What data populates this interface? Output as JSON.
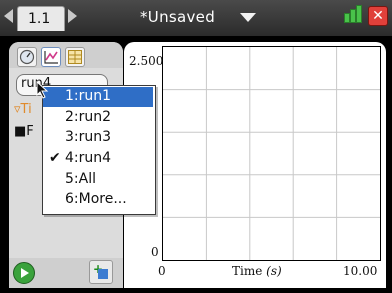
{
  "topbar": {
    "page_tab": "1.1",
    "document_title": "*Unsaved",
    "close_symbol": "✕"
  },
  "left_panel": {
    "run_selector_value": "run4",
    "tree_label": "▿Ti",
    "legend_label": "■F"
  },
  "graph": {
    "y_max": "2.500",
    "y_min": "0",
    "x_min": "0",
    "x_max": "10.00",
    "x_label": "Time",
    "x_unit": "(s)"
  },
  "dropdown": {
    "items": [
      {
        "label": "1:run1",
        "highlighted": true,
        "checked": false
      },
      {
        "label": "2:run2",
        "highlighted": false,
        "checked": false
      },
      {
        "label": "3:run3",
        "highlighted": false,
        "checked": false
      },
      {
        "label": "4:run4",
        "highlighted": false,
        "checked": true
      },
      {
        "label": "5:All",
        "highlighted": false,
        "checked": false
      },
      {
        "label": "6:More...",
        "highlighted": false,
        "checked": false
      }
    ],
    "check_symbol": "✔"
  },
  "colors": {
    "menu_highlight": "#2f6ec6",
    "play_green": "#3aa23c",
    "close_red": "#e0403a",
    "tree_orange": "#e08a2b"
  }
}
